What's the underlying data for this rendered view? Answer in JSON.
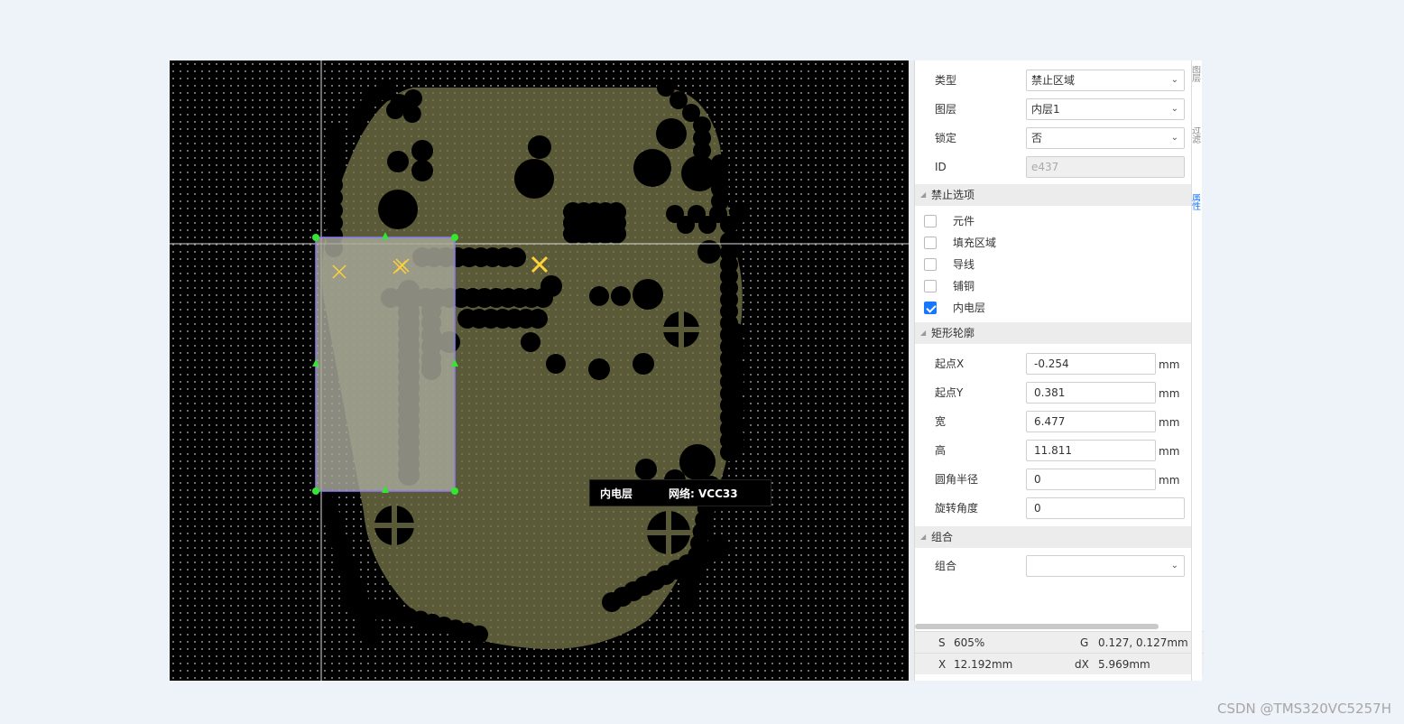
{
  "canvas": {
    "tooltip": {
      "layer": "内电层",
      "net": "网络: VCC33"
    }
  },
  "right_tabs": [
    "图层",
    "过滤",
    "属性"
  ],
  "properties": {
    "type": {
      "label": "类型",
      "value": "禁止区域"
    },
    "layer": {
      "label": "图层",
      "value": "内层1"
    },
    "locked": {
      "label": "锁定",
      "value": "否"
    },
    "id": {
      "label": "ID",
      "value": "e437"
    },
    "forbid_section": "禁止选项",
    "forbid_options": [
      {
        "label": "元件",
        "checked": false
      },
      {
        "label": "填充区域",
        "checked": false
      },
      {
        "label": "导线",
        "checked": false
      },
      {
        "label": "铺铜",
        "checked": false
      },
      {
        "label": "内电层",
        "checked": true
      }
    ],
    "rect_section": "矩形轮廓",
    "start_x": {
      "label": "起点X",
      "value": "-0.254",
      "unit": "mm"
    },
    "start_y": {
      "label": "起点Y",
      "value": "0.381",
      "unit": "mm"
    },
    "width": {
      "label": "宽",
      "value": "6.477",
      "unit": "mm"
    },
    "height": {
      "label": "高",
      "value": "11.811",
      "unit": "mm"
    },
    "radius": {
      "label": "圆角半径",
      "value": "0",
      "unit": "mm"
    },
    "rotation": {
      "label": "旋转角度",
      "value": "0"
    },
    "group_section": "组合",
    "group": {
      "label": "组合",
      "value": ""
    }
  },
  "status": {
    "s_label": "S",
    "s_value": "605%",
    "g_label": "G",
    "g_value": "0.127, 0.127mm",
    "x_label": "X",
    "x_value": "12.192mm",
    "dx_label": "dX",
    "dx_value": "5.969mm"
  },
  "watermark": "CSDN @TMS320VC5257H",
  "colors": {
    "canvas_bg": "#000000",
    "plane_fill": "#5a5a38",
    "forbid_region": "#a8a89a",
    "selection_outline": "#8a7cf0",
    "handle": "#32e632",
    "accent": "#1677ff"
  }
}
